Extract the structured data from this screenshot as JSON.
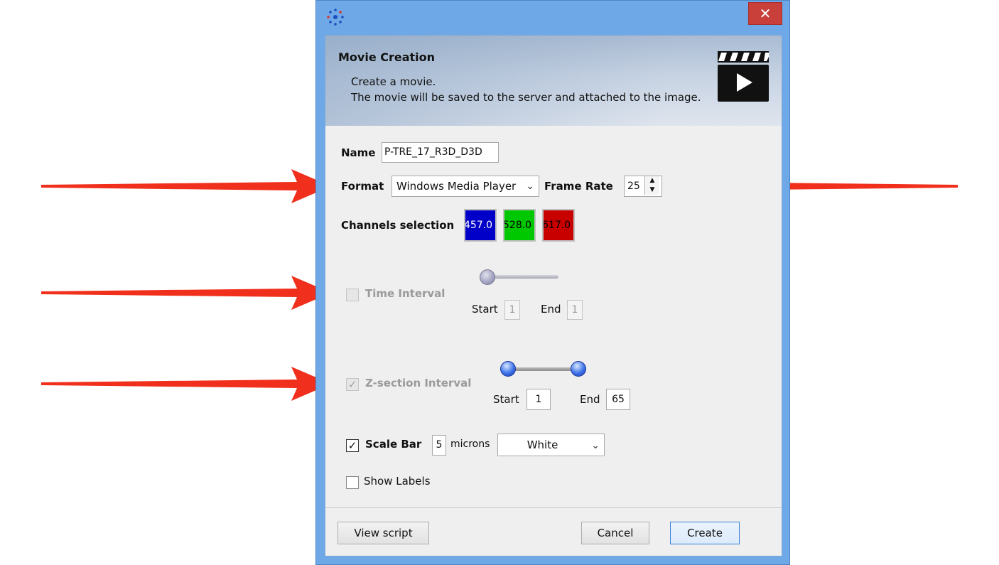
{
  "dialog": {
    "close_glyph": "✕",
    "banner": {
      "title": "Movie Creation",
      "desc_line1": "Create a movie.",
      "desc_line2": "The movie will be saved to the server and attached to the image."
    },
    "name": {
      "label": "Name",
      "value": "P-TRE_17_R3D_D3D"
    },
    "format": {
      "label": "Format",
      "selected": "Windows Media Player"
    },
    "frame_rate": {
      "label": "Frame Rate",
      "value": "25"
    },
    "channels": {
      "label": "Channels selection",
      "items": [
        {
          "label": "457.0",
          "color": "#0000c8"
        },
        {
          "label": "528.0",
          "color": "#00c800"
        },
        {
          "label": "617.0",
          "color": "#c80000"
        }
      ]
    },
    "time_interval": {
      "label": "Time Interval",
      "checked": false,
      "enabled": false,
      "start_label": "Start",
      "start_value": "1",
      "end_label": "End",
      "end_value": "1"
    },
    "z_interval": {
      "label": "Z-section Interval",
      "checked": true,
      "enabled": false,
      "start_label": "Start",
      "start_value": "1",
      "end_label": "End",
      "end_value": "65"
    },
    "scale_bar": {
      "label": "Scale Bar",
      "checked": true,
      "value": "5",
      "unit": "microns",
      "color": "White"
    },
    "show_labels": {
      "label": "Show Labels",
      "checked": false
    },
    "buttons": {
      "view_script": "View script",
      "cancel": "Cancel",
      "create": "Create"
    }
  },
  "annotation_color": "#f0301c",
  "window_color": "#6fa8e6"
}
